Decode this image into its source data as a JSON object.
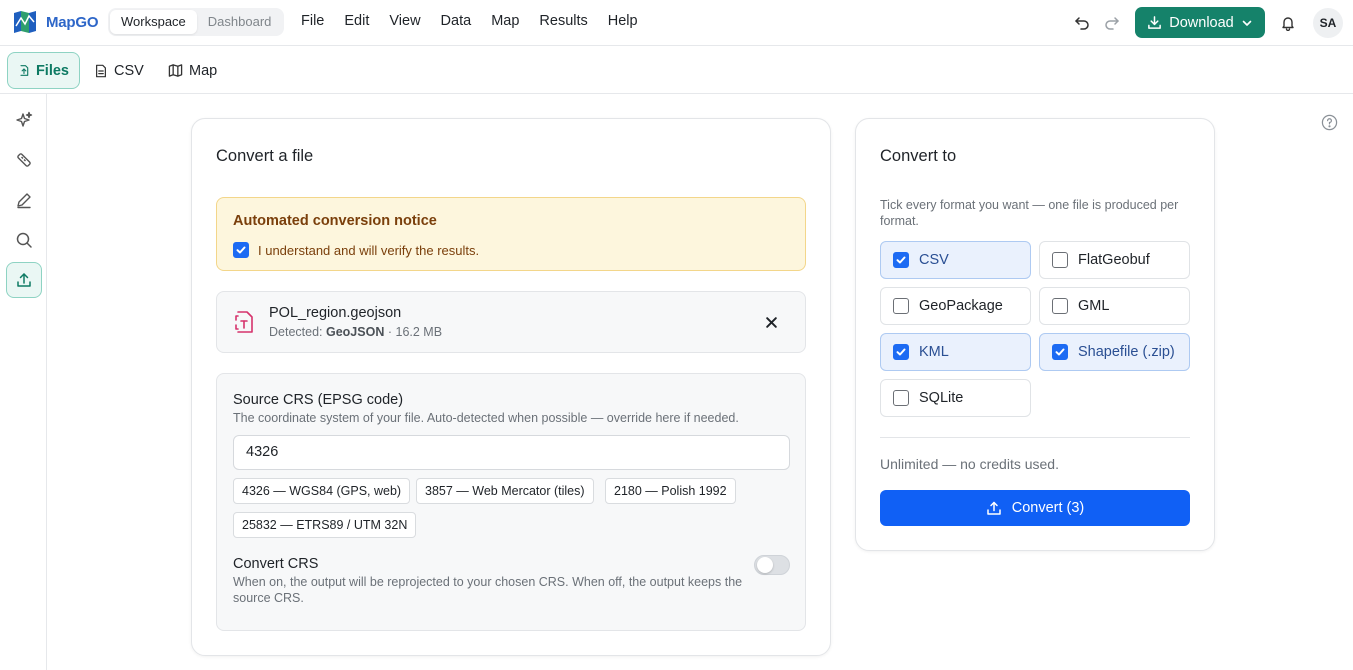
{
  "app": {
    "name": "MapGO",
    "accent": "#15826a",
    "primary": "#1060f5"
  },
  "mode_switch": [
    "Workspace",
    "Dashboard"
  ],
  "menu": [
    "File",
    "Edit",
    "View",
    "Data",
    "Map",
    "Results",
    "Help"
  ],
  "toolbar": {
    "download_label": "Download",
    "avatar_initials": "SA",
    "icons": [
      "undo-icon",
      "redo-icon",
      "bell-icon"
    ]
  },
  "subtabs": [
    {
      "label": "Files",
      "icon": "file-upload-icon",
      "active": true
    },
    {
      "label": "CSV",
      "icon": "csv-file-icon",
      "active": false
    },
    {
      "label": "Map",
      "icon": "map-icon",
      "active": false
    }
  ],
  "rail": [
    "sparkles-icon",
    "ruler-icon",
    "pencil-icon",
    "search-icon",
    "upload-icon"
  ],
  "convert_card": {
    "title": "Convert a file",
    "notice": {
      "title": "Automated conversion notice",
      "checkbox_label": "I understand and will verify the results.",
      "checked": true
    },
    "file": {
      "name": "POL_region.geojson",
      "detected_prefix": "Detected:",
      "format": "GeoJSON",
      "separator": "·",
      "size": "16.2 MB"
    },
    "source_crs": {
      "label": "Source CRS (EPSG code)",
      "hint": "The coordinate system of your file. Auto-detected when possible — override here if needed.",
      "value": "4326",
      "presets": [
        "4326 — WGS84 (GPS, web)",
        "3857 — Web Mercator (tiles)",
        "2180 — Polish 1992",
        "25832 — ETRS89 / UTM 32N"
      ]
    },
    "convert_crs": {
      "label": "Convert CRS",
      "hint": "When on, the output will be reprojected to your chosen CRS. When off, the output keeps the source CRS.",
      "enabled": false
    }
  },
  "target_card": {
    "title": "Convert to",
    "hint": "Tick every format you want — one file is produced per format.",
    "formats": [
      {
        "label": "CSV",
        "checked": true
      },
      {
        "label": "FlatGeobuf",
        "checked": false
      },
      {
        "label": "GeoPackage",
        "checked": false
      },
      {
        "label": "GML",
        "checked": false
      },
      {
        "label": "KML",
        "checked": true
      },
      {
        "label": "Shapefile (.zip)",
        "checked": true
      },
      {
        "label": "SQLite",
        "checked": false
      }
    ],
    "credits": "Unlimited — no credits used.",
    "convert_label": "Convert (3)"
  }
}
